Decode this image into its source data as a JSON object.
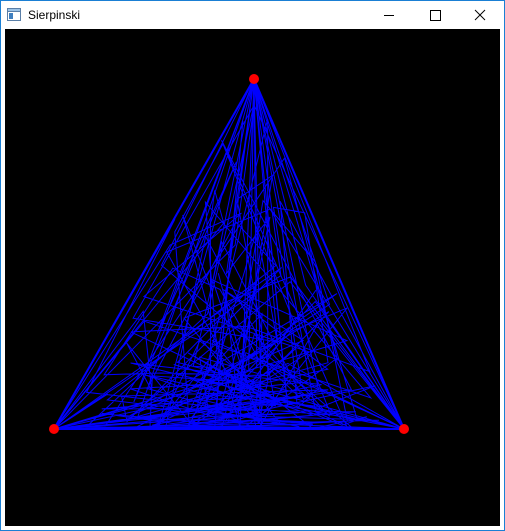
{
  "window": {
    "title": "Sierpinski",
    "app_icon": "app-window-icon",
    "controls": [
      {
        "name": "minimize-button",
        "icon": "minimize-icon"
      },
      {
        "name": "maximize-button",
        "icon": "maximize-icon"
      },
      {
        "name": "close-button",
        "icon": "close-icon"
      }
    ]
  },
  "canvas": {
    "background": "#000000",
    "line_color": "#0000ff",
    "vertex_color": "#ff0000"
  }
}
